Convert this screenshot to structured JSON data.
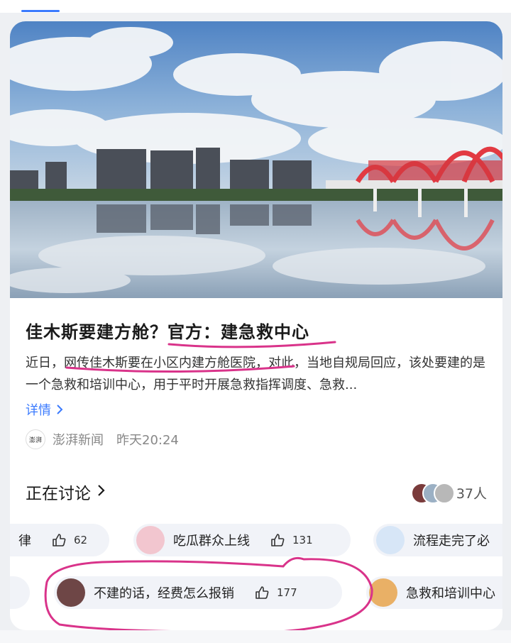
{
  "colors": {
    "accent": "#3a7afe",
    "annotation": "#d9338a"
  },
  "article": {
    "title_part1": "佳木斯要建方舱？",
    "title_part2": "官方：建急救中心",
    "summary_part1": "近日，",
    "summary_highlight": "网传佳木斯要在小区内建方舱医院",
    "summary_part2": "，对此，当地自规局回应，该处要建的是一个急救和培训中心，用于平时开展急救指挥调度、急救...",
    "more_label": "详情",
    "more_icon": "chevron-right-icon",
    "source_logo_text": "澎湃",
    "source_name": "澎湃新闻",
    "time": "昨天20:24"
  },
  "discussion": {
    "heading": "正在讨论",
    "participants": "37人"
  },
  "comments_row1": [
    {
      "text": "律",
      "likes": "62"
    },
    {
      "text": "吃瓜群众上线",
      "likes": "131"
    },
    {
      "text": "流程走完了必"
    }
  ],
  "comments_row2": [
    {
      "text": "不建的话，经费怎么报销",
      "likes": "177"
    },
    {
      "text": "急救和培训中心"
    }
  ]
}
